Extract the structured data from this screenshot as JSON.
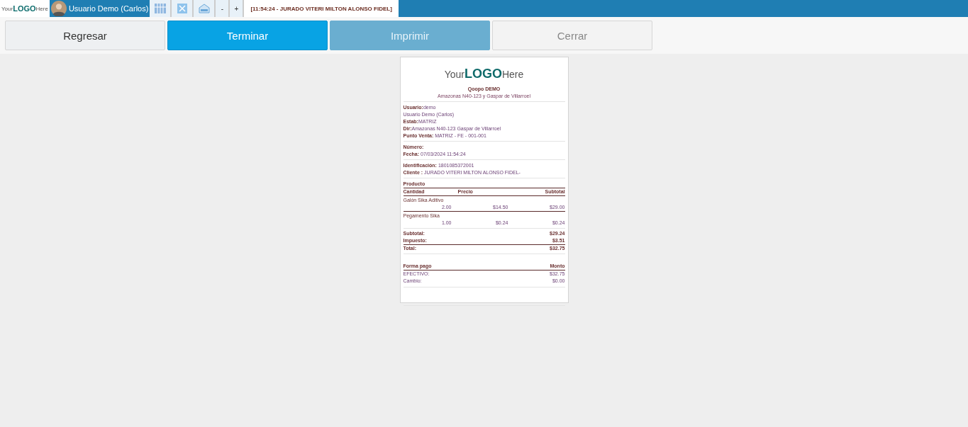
{
  "topbar": {
    "logo": {
      "pre": "Your",
      "main": "LOGO",
      "post": "Here"
    },
    "user": "Usuario Demo (Carlos)",
    "tools": [
      {
        "kind": "grid"
      },
      {
        "kind": "close"
      },
      {
        "kind": "box"
      },
      {
        "kind": "text",
        "label": "-"
      },
      {
        "kind": "text",
        "label": "+"
      }
    ],
    "tabs": [
      {
        "label": "[11:54:24 - JURADO VITERI MILTON ALONSO FIDEL]",
        "selected": true
      }
    ]
  },
  "actions": [
    {
      "label": "Regresar",
      "kind": "default",
      "disabled": false
    },
    {
      "label": "Terminar",
      "kind": "primary",
      "disabled": false
    },
    {
      "label": "Imprimir",
      "kind": "primary",
      "disabled": true
    },
    {
      "label": "Cerrar",
      "kind": "default",
      "disabled": true
    }
  ],
  "receipt": {
    "logo": {
      "pre": "Your",
      "main": "LOGO",
      "post": "Here"
    },
    "company": "Qoopo DEMO",
    "address": "Amazonas N40-123 y Gaspar de Villarroel",
    "sections": [
      [
        {
          "label": "Usuario:",
          "value": "demo"
        },
        {
          "value": "Usuario Demo (Carlos)"
        },
        {
          "label": "Estab:",
          "value": "MATRIZ"
        },
        {
          "label": "Dir:",
          "value": "Amazonas N40-123 Gaspar de Villarroel"
        },
        {
          "label": "Punto Venta:",
          "value": " MATRIZ - FE - 001-001"
        }
      ],
      [
        {
          "label": "Número:"
        },
        {
          "label": "Fecha:",
          "value": " 07/03/2024 11:54:24"
        }
      ],
      [
        {
          "label": "Identificación:",
          "value": " 1801085372001"
        },
        {
          "label": "Cliente :",
          "value": " JURADO VITERI MILTON ALONSO FIDEL-"
        }
      ]
    ],
    "products": {
      "title": "Producto",
      "columns": [
        "Cantidad",
        "Precio",
        "Subtotal"
      ],
      "items": [
        {
          "name": "Galón Sika Aditivo",
          "qty": "2.00",
          "price": "$14.50",
          "subtotal": "$29.00"
        },
        {
          "name": "Pegamento Sika",
          "qty": "1.00",
          "price": "$0.24",
          "subtotal": "$0.24"
        }
      ]
    },
    "totals": [
      {
        "label": "Subtotal:",
        "value": "$29.24",
        "kind": "plain"
      },
      {
        "label": "Impuesto:",
        "value": "$3.51",
        "kind": "plain"
      },
      {
        "label": "Total:",
        "value": "$32.75",
        "kind": "total"
      }
    ],
    "payments": {
      "columns": [
        "Forma pago",
        "Monto"
      ],
      "rows": [
        {
          "label": "EFECTIVO:",
          "value": "$32.75"
        },
        {
          "label": "Cambio:",
          "value": "$0.00"
        }
      ]
    }
  }
}
